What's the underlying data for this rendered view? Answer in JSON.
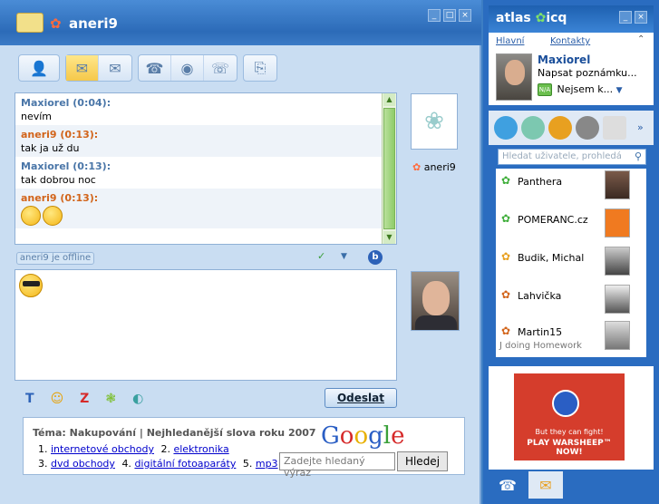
{
  "chat": {
    "title": "aneri9",
    "messages": [
      {
        "author": "Maxiorel (0:04):",
        "text": "nevím",
        "color": "blue"
      },
      {
        "author": "aneri9 (0:13):",
        "text": "tak ja už du",
        "color": "orange"
      },
      {
        "author": "Maxiorel (0:13):",
        "text": "tak dobrou noc",
        "color": "blue"
      },
      {
        "author": "aneri9 (0:13):",
        "text": "",
        "color": "orange"
      }
    ],
    "contact_name": "aneri9",
    "status_label": "aneri9 je offline",
    "send_label": "Odeslat"
  },
  "ad": {
    "topic": "Téma: Nakupování  |  Nejhledanější slova roku 2007",
    "row1": {
      "n1": "1.",
      "l1": "internetové obchody",
      "n2": "2.",
      "l2": "elektronika"
    },
    "row2": {
      "n3": "3.",
      "l3": "dvd obchody",
      "n4": "4.",
      "l4": "digitální fotoaparáty",
      "n5": "5.",
      "l5": "mp3"
    },
    "google": "Google",
    "search_placeholder": "Zadejte hledaný výraz",
    "search_button": "Hledej"
  },
  "side": {
    "brand": "atlas",
    "brand2": "icq",
    "nav": {
      "home": "Hlavní",
      "contacts": "Kontakty"
    },
    "profile": {
      "name": "Maxiorel",
      "note": "Napsat poznámku...",
      "status": "Nejsem k...",
      "badge": "N/A"
    },
    "search_placeholder": "Hledat uživatele, prohledá",
    "contacts": [
      {
        "name": "Panthera",
        "sub": ""
      },
      {
        "name": "POMERANC.cz",
        "sub": ""
      },
      {
        "name": "Budik, Michal",
        "sub": ""
      },
      {
        "name": "Lahvička",
        "sub": ""
      },
      {
        "name": "Martin15",
        "sub": "J doing Homework"
      }
    ],
    "ad": {
      "line1": "But they can fight!",
      "line2": "PLAY WARSHEEP™ NOW!"
    }
  }
}
